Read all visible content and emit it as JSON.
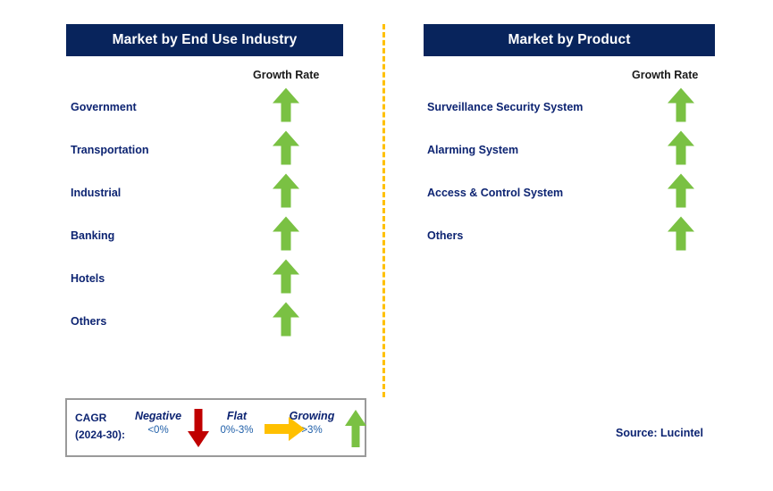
{
  "panels": [
    {
      "id": "end-use-industry",
      "title": "Market by End Use Industry",
      "column_header": "Growth Rate",
      "rows": [
        {
          "label": "Government",
          "growth": "growing"
        },
        {
          "label": "Transportation",
          "growth": "growing"
        },
        {
          "label": "Industrial",
          "growth": "growing"
        },
        {
          "label": "Banking",
          "growth": "growing"
        },
        {
          "label": "Hotels",
          "growth": "growing"
        },
        {
          "label": "Others",
          "growth": "growing"
        }
      ]
    },
    {
      "id": "product",
      "title": "Market by Product",
      "column_header": "Growth Rate",
      "rows": [
        {
          "label": "Surveillance Security System",
          "growth": "growing"
        },
        {
          "label": "Alarming System",
          "growth": "growing"
        },
        {
          "label": "Access & Control System",
          "growth": "growing"
        },
        {
          "label": "Others",
          "growth": "growing"
        }
      ]
    }
  ],
  "legend": {
    "cagr_line1": "CAGR",
    "cagr_line2": "(2024-30):",
    "items": [
      {
        "title": "Negative",
        "value": "<0%",
        "icon": "arrow-down-red"
      },
      {
        "title": "Flat",
        "value": "0%-3%",
        "icon": "arrow-right-orange"
      },
      {
        "title": "Growing",
        "value": ">3%",
        "icon": "arrow-up-green"
      }
    ]
  },
  "source": "Source: Lucintel",
  "colors": {
    "header_navy": "#08245c",
    "label_navy": "#0d2472",
    "growing_green": "#7ac143",
    "negative_red": "#c00000",
    "flat_orange": "#ffc000",
    "divider_orange": "#ffc000",
    "legend_border": "#9a9a9a"
  }
}
